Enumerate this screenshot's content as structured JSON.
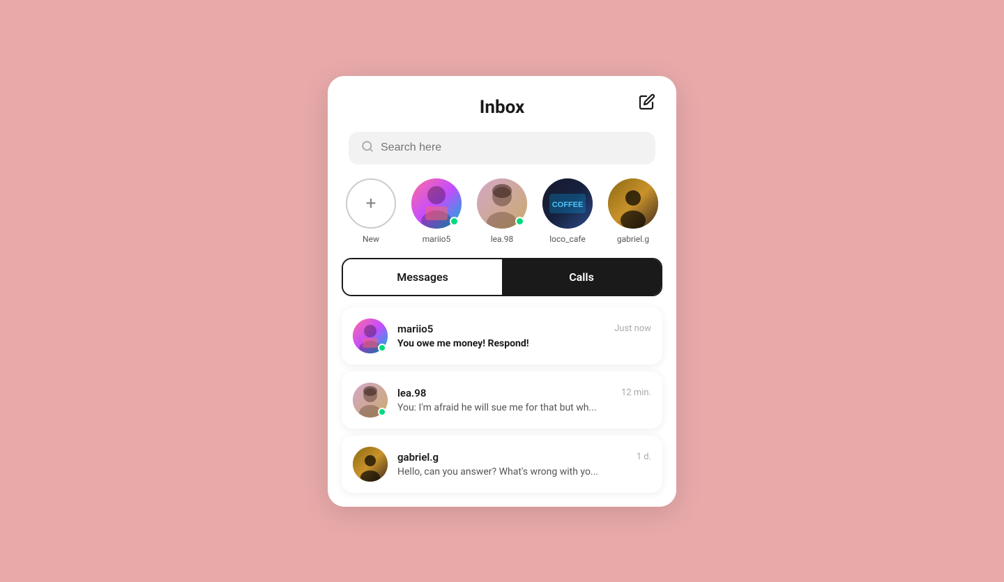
{
  "header": {
    "title": "Inbox",
    "compose_label": "compose"
  },
  "search": {
    "placeholder": "Search here"
  },
  "stories": [
    {
      "id": "new",
      "name": "New",
      "avatar_type": "new",
      "online": false
    },
    {
      "id": "mariio5",
      "name": "mariio5",
      "avatar_type": "mariio5",
      "online": true
    },
    {
      "id": "lea98",
      "name": "lea.98",
      "avatar_type": "lea98",
      "online": true
    },
    {
      "id": "loco_cafe",
      "name": "loco_cafe",
      "avatar_type": "loco_cafe",
      "online": false
    },
    {
      "id": "gabriel_g",
      "name": "gabriel.g",
      "avatar_type": "gabriel_g",
      "online": false
    }
  ],
  "tabs": [
    {
      "id": "messages",
      "label": "Messages",
      "active": true
    },
    {
      "id": "calls",
      "label": "Calls",
      "active": false
    }
  ],
  "messages": [
    {
      "id": "msg1",
      "name": "mariio5",
      "time": "Just now",
      "preview": "You owe me money! Respond!",
      "unread": true,
      "online": true,
      "avatar_type": "mariio5"
    },
    {
      "id": "msg2",
      "name": "lea.98",
      "time": "12 min.",
      "preview": "You: I'm afraid he will sue me for that but wh...",
      "unread": false,
      "online": true,
      "avatar_type": "lea98"
    },
    {
      "id": "msg3",
      "name": "gabriel.g",
      "time": "1 d.",
      "preview": "Hello, can you answer? What's wrong with yo...",
      "unread": false,
      "online": false,
      "avatar_type": "gabriel_g"
    }
  ],
  "colors": {
    "background": "#e8a9a9",
    "card_bg": "#ffffff",
    "online_dot": "#00d97e",
    "tab_active_bg": "#1a1a1a",
    "tab_active_text": "#ffffff"
  }
}
